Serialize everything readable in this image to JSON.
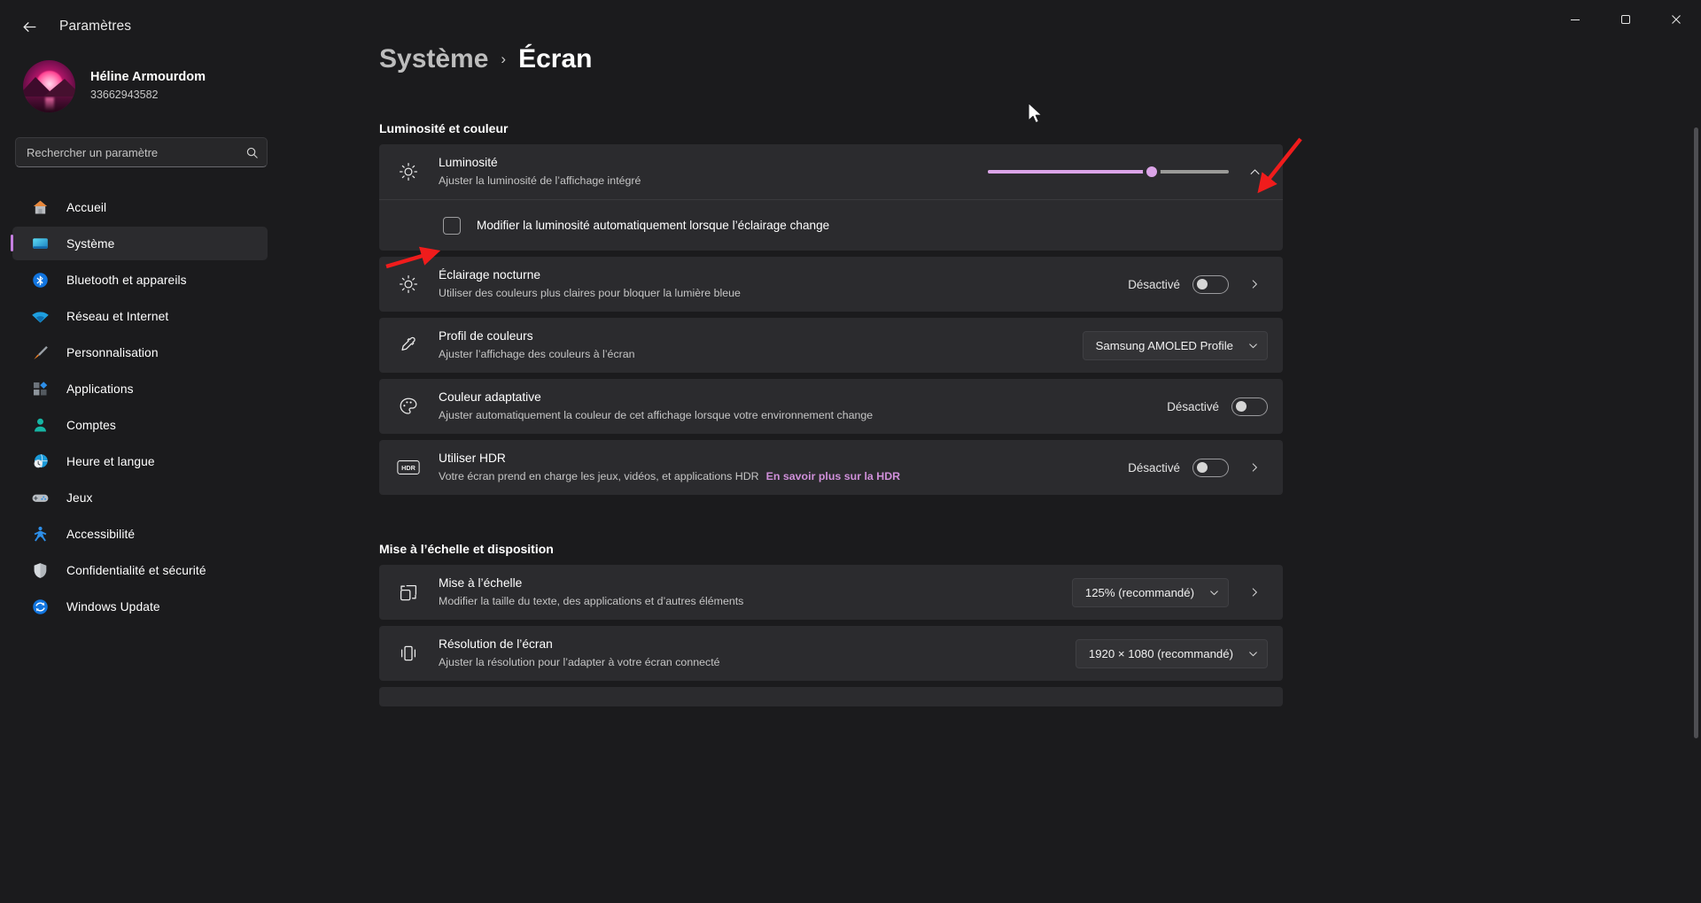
{
  "window": {
    "title": "Paramètres",
    "back_icon": "arrow-left-icon",
    "minimize_icon": "minimize-icon",
    "maximize_icon": "maximize-icon",
    "close_icon": "close-icon"
  },
  "sidebar": {
    "profile": {
      "name": "Héline Armourdom",
      "account": "33662943582",
      "avatar_icon": "avatar-image"
    },
    "search": {
      "placeholder": "Rechercher un paramètre",
      "value": "",
      "icon": "search-icon"
    },
    "items": [
      {
        "label": "Accueil",
        "icon": "home-icon",
        "active": false
      },
      {
        "label": "Système",
        "icon": "monitor-icon",
        "active": true
      },
      {
        "label": "Bluetooth et appareils",
        "icon": "bluetooth-icon",
        "active": false
      },
      {
        "label": "Réseau et Internet",
        "icon": "wifi-icon",
        "active": false
      },
      {
        "label": "Personnalisation",
        "icon": "paintbrush-icon",
        "active": false
      },
      {
        "label": "Applications",
        "icon": "apps-icon",
        "active": false
      },
      {
        "label": "Comptes",
        "icon": "account-icon",
        "active": false
      },
      {
        "label": "Heure et langue",
        "icon": "clock-globe-icon",
        "active": false
      },
      {
        "label": "Jeux",
        "icon": "gamepad-icon",
        "active": false
      },
      {
        "label": "Accessibilité",
        "icon": "accessibility-icon",
        "active": false
      },
      {
        "label": "Confidentialité et sécurité",
        "icon": "shield-icon",
        "active": false
      },
      {
        "label": "Windows Update",
        "icon": "update-icon",
        "active": false
      }
    ]
  },
  "breadcrumb": {
    "parent": "Système",
    "separator": "›",
    "current": "Écran"
  },
  "sections": [
    {
      "title": "Luminosité et couleur",
      "rows": [
        {
          "id": "brightness",
          "title": "Luminosité",
          "subtitle": "Ajuster la luminosité de l’affichage intégré",
          "icon": "brightness-icon",
          "control": "slider",
          "slider_percent": 68,
          "expand_icon": "chevron-up-icon"
        },
        {
          "id": "auto-brightness",
          "checkbox_label": "Modifier la luminosité automatiquement lorsque l’éclairage change",
          "checked": false,
          "control": "checkbox"
        },
        {
          "id": "night-light",
          "title": "Éclairage nocturne",
          "subtitle": "Utiliser des couleurs plus claires pour bloquer la lumière bleue",
          "icon": "night-light-icon",
          "control": "toggle",
          "state_label": "Désactivé",
          "toggle_on": false,
          "chevron_icon": "chevron-right-icon"
        },
        {
          "id": "color-profile",
          "title": "Profil de couleurs",
          "subtitle": "Ajuster l’affichage des couleurs à l’écran",
          "icon": "eyedropper-icon",
          "control": "dropdown",
          "dropdown_value": "Samsung AMOLED Profile",
          "chevron_icon": "chevron-down-icon"
        },
        {
          "id": "adaptive-color",
          "title": "Couleur adaptative",
          "subtitle": "Ajuster automatiquement la couleur de cet affichage lorsque votre environnement change",
          "icon": "palette-icon",
          "control": "toggle",
          "state_label": "Désactivé",
          "toggle_on": false
        },
        {
          "id": "use-hdr",
          "title": "Utiliser HDR",
          "subtitle": "Votre écran prend en charge les jeux, vidéos, et applications HDR",
          "link_text": "En savoir plus sur la HDR",
          "icon": "hdr-icon",
          "control": "toggle",
          "state_label": "Désactivé",
          "toggle_on": false,
          "chevron_icon": "chevron-right-icon"
        }
      ]
    },
    {
      "title": "Mise à l’échelle et disposition",
      "rows": [
        {
          "id": "scale",
          "title": "Mise à l’échelle",
          "subtitle": "Modifier la taille du texte, des applications et d’autres éléments",
          "icon": "scale-icon",
          "control": "dropdown",
          "dropdown_value": "125% (recommandé)",
          "chevron_icon": "chevron-right-icon"
        },
        {
          "id": "resolution",
          "title": "Résolution de l’écran",
          "subtitle": "Ajuster la résolution pour l’adapter à  votre  écran connecté",
          "icon": "resolution-icon",
          "control": "dropdown",
          "dropdown_value": "1920 × 1080 (recommandé)",
          "chevron_icon": "chevron-down-icon"
        }
      ]
    }
  ],
  "annotations": [
    {
      "name": "arrow-to-expand-brightness",
      "color": "#f01c1c"
    },
    {
      "name": "arrow-to-auto-brightness-checkbox",
      "color": "#f01c1c"
    }
  ],
  "colors": {
    "accent": "#c57fe0",
    "link": "#cf8fd9",
    "slider_fill": "#dba4e8",
    "card_bg": "#2b2b2e",
    "page_bg": "#1b1b1d",
    "annotation_red": "#f01c1c"
  }
}
